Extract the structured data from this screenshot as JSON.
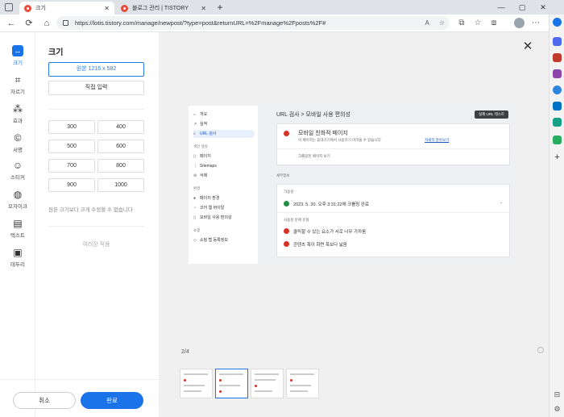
{
  "browser": {
    "tabs": [
      {
        "title": "크기",
        "active": true
      },
      {
        "title": "블로그 관리 | TISTORY",
        "active": false
      }
    ],
    "url": "https://lotis.tistory.com/manage/newpost/?type=post&returnURL=%2Fmanage%2Fposts%2F#"
  },
  "tools": [
    {
      "icon": "resize-icon",
      "label": "크기",
      "active": true
    },
    {
      "icon": "crop-icon",
      "label": "자르기"
    },
    {
      "icon": "effects-icon",
      "label": "효과"
    },
    {
      "icon": "signature-icon",
      "label": "서명"
    },
    {
      "icon": "sticker-icon",
      "label": "스티커"
    },
    {
      "icon": "mosaic-icon",
      "label": "모자이크"
    },
    {
      "icon": "text-icon",
      "label": "텍스트"
    },
    {
      "icon": "frame-icon",
      "label": "테두리"
    }
  ],
  "panel": {
    "title": "크기",
    "original": "원본 1216 x 582",
    "manual": "직접 입력",
    "sizes": [
      "300",
      "400",
      "500",
      "600",
      "700",
      "800",
      "900",
      "1000"
    ],
    "note": "원본 크기보다 크게 수정할 수 없습니다",
    "apply_all": "여러장 적용",
    "cancel": "취소",
    "done": "완료"
  },
  "canvas": {
    "page_indicator": "2/4",
    "shot": {
      "nav": [
        {
          "icon": "home",
          "label": "개요"
        },
        {
          "icon": "trend",
          "label": "실적"
        },
        {
          "icon": "search",
          "label": "URL 검사",
          "selected": true
        }
      ],
      "nav_section1": "색인 생성",
      "nav2": [
        {
          "icon": "page",
          "label": "페이지"
        },
        {
          "icon": "sitemap",
          "label": "Sitemaps"
        },
        {
          "icon": "remove",
          "label": "삭제"
        }
      ],
      "nav_section2": "환경",
      "nav3": [
        {
          "icon": "exp",
          "label": "페이지 환경"
        },
        {
          "icon": "cwv",
          "label": "코어 웹 바이탈"
        },
        {
          "icon": "mobile",
          "label": "모바일 사용 편의성"
        }
      ],
      "nav_section3": "쇼핑",
      "nav4": [
        {
          "icon": "tag",
          "label": "쇼핑 탭 등록정보"
        }
      ],
      "breadcrumb": "URL 검사  >  모바일 사용 편의성",
      "live_test": "실제 URL 테스트",
      "error_title": "모바일 친화적 페이지",
      "error_desc": "이 페이지는 휴대기기에서 사용하기 어려울 수 있습니다.",
      "error_link": "자세히 알아보기",
      "view_page": "크롤링된 페이지 보기",
      "details_label": "세부정보",
      "crawl_label": "가용성",
      "crawl_value": "2023. 5. 30. 오후 3:31:22에 크롤링 완료",
      "issues_label": "사용성 문제 유형",
      "issue1": "클릭할 수 있는 요소가 서로 너무 가까움",
      "issue2": "콘텐츠 폭이 화면 폭보다 넓음"
    }
  }
}
